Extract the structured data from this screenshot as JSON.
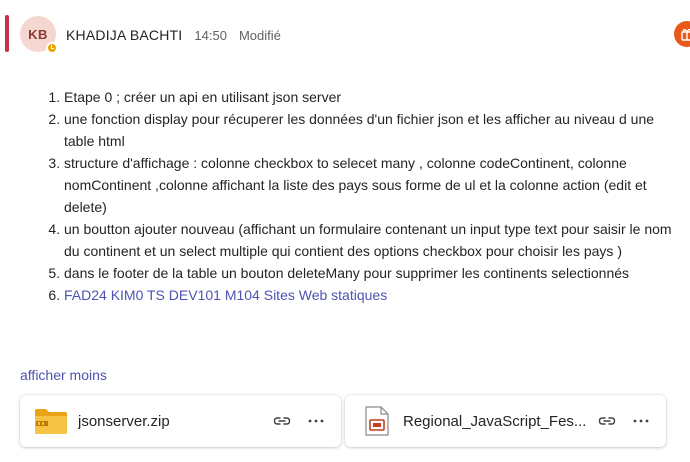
{
  "message": {
    "avatar_initials": "KB",
    "author": "KHADIJA BACHTI",
    "time": "14:50",
    "edited_label": "Modifié",
    "items": [
      "Etape 0 ; créer un api en utilisant json server",
      "une fonction display pour récuperer les données d'un fichier json et les afficher au niveau d une table html",
      "structure d'affichage : colonne checkbox to selecet many , colonne codeContinent, colonne nomContinent ,colonne affichant la liste des pays sous forme de ul et la colonne action (edit et delete)",
      "un boutton ajouter nouveau (affichant un formulaire contenant un input type text pour saisir le nom du continent et un select multiple qui contient des options checkbox pour choisir les pays )",
      "dans le footer de la table un bouton deleteMany pour supprimer les continents selectionnés"
    ],
    "link_item": "FAD24 KIM0 TS DEV101 M104 Sites Web statiques",
    "show_less": "afficher moins"
  },
  "attachments": [
    {
      "name": "jsonserver.zip",
      "icon": "zip-folder-icon"
    },
    {
      "name": "Regional_JavaScript_Fes...",
      "icon": "presentation-file-icon"
    }
  ],
  "colors": {
    "accent_bar": "#c4314b",
    "avatar_bg": "#f5d6d0",
    "link": "#4f52b2",
    "status": "#eaa300",
    "reaction": "#e8591a"
  }
}
